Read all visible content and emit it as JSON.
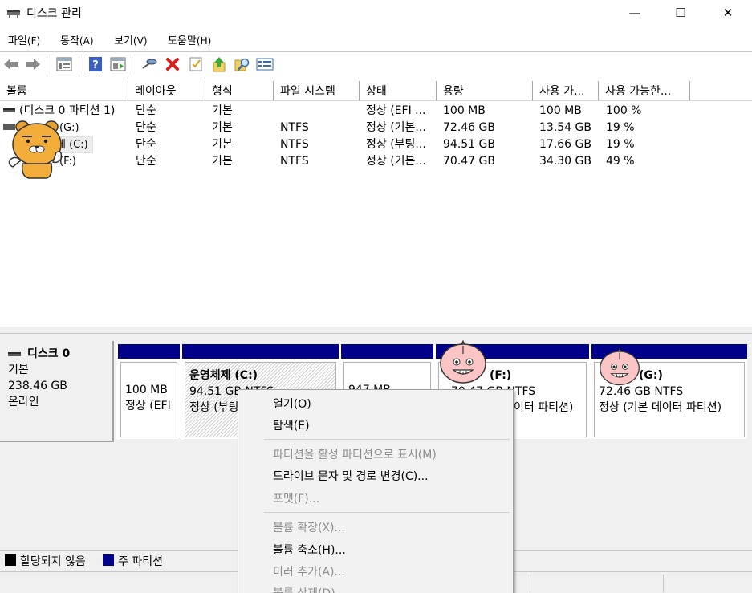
{
  "window": {
    "title": "디스크 관리",
    "minimize_glyph": "—",
    "maximize_glyph": "☐",
    "close_glyph": "✕"
  },
  "menu": [
    {
      "label": "파일",
      "accel": "(F)"
    },
    {
      "label": "동작",
      "accel": "(A)"
    },
    {
      "label": "보기",
      "accel": "(V)"
    },
    {
      "label": "도움말",
      "accel": "(H)"
    }
  ],
  "toolbar": {
    "icons": [
      "back-icon",
      "forward-icon",
      "list-view-icon",
      "help-icon",
      "properties-view-icon",
      "connect-icon",
      "delete-icon",
      "checklist-icon",
      "up-icon",
      "search-icon",
      "details-icon"
    ]
  },
  "table": {
    "columns": [
      "볼륨",
      "레이아웃",
      "형식",
      "파일 시스템",
      "상태",
      "용량",
      "사용 가...",
      "사용 가능한..."
    ],
    "rows": [
      {
        "volume": "(디스크 0 파티션 1)",
        "layout": "단순",
        "type": "기본",
        "fs": "",
        "status": "정상 (EFI ...",
        "capacity": "100 MB",
        "free": "100 MB",
        "pct": "100 %"
      },
      {
        "volume": "(G:)",
        "layout": "단순",
        "type": "기본",
        "fs": "NTFS",
        "status": "정상 (기본...",
        "capacity": "72.46 GB",
        "free": "13.54 GB",
        "pct": "19 %"
      },
      {
        "volume": "체 (C:)",
        "layout": "단순",
        "type": "기본",
        "fs": "NTFS",
        "status": "정상 (부팅...",
        "capacity": "94.51 GB",
        "free": "17.66 GB",
        "pct": "19 %"
      },
      {
        "volume": "(F:)",
        "layout": "단순",
        "type": "기본",
        "fs": "NTFS",
        "status": "정상 (기본...",
        "capacity": "70.47 GB",
        "free": "34.30 GB",
        "pct": "49 %"
      }
    ]
  },
  "disk": {
    "name": "디스크 0",
    "type": "기본",
    "size": "238.46 GB",
    "state": "온라인"
  },
  "partitions": [
    {
      "name": "",
      "size": "100 MB",
      "status": "정상 (EFI"
    },
    {
      "name": "운영체제  (C:)",
      "size": "94.51 GB NTFS",
      "status": "정상 (부팅"
    },
    {
      "name": "",
      "size": "947 MB",
      "status": ""
    },
    {
      "name": "(F:)",
      "size": "70.47 GB NTFS",
      "status": "이터 파티션)"
    },
    {
      "name": "(G:)",
      "size": "72.46 GB NTFS",
      "status": "정상 (기본 데이터 파티션)"
    }
  ],
  "legend": {
    "unallocated": "할당되지 않음",
    "primary": "주 파티션",
    "colors": {
      "unallocated": "#000000",
      "primary": "#00008b"
    }
  },
  "context_menu": {
    "items": [
      {
        "label": "열기(O)",
        "enabled": true
      },
      {
        "label": "탐색(E)",
        "enabled": true
      },
      {
        "label": "파티션을 활성 파티션으로 표시(M)",
        "enabled": false
      },
      {
        "label": "드라이브 문자 및 경로 변경(C)...",
        "enabled": true
      },
      {
        "label": "포맷(F)...",
        "enabled": false
      },
      {
        "label": "볼륨 확장(X)...",
        "enabled": false
      },
      {
        "label": "볼륨 축소(H)...",
        "enabled": true
      },
      {
        "label": "미러 추가(A)...",
        "enabled": false
      },
      {
        "label": "볼륨 삭제(D)...",
        "enabled": false
      }
    ]
  }
}
